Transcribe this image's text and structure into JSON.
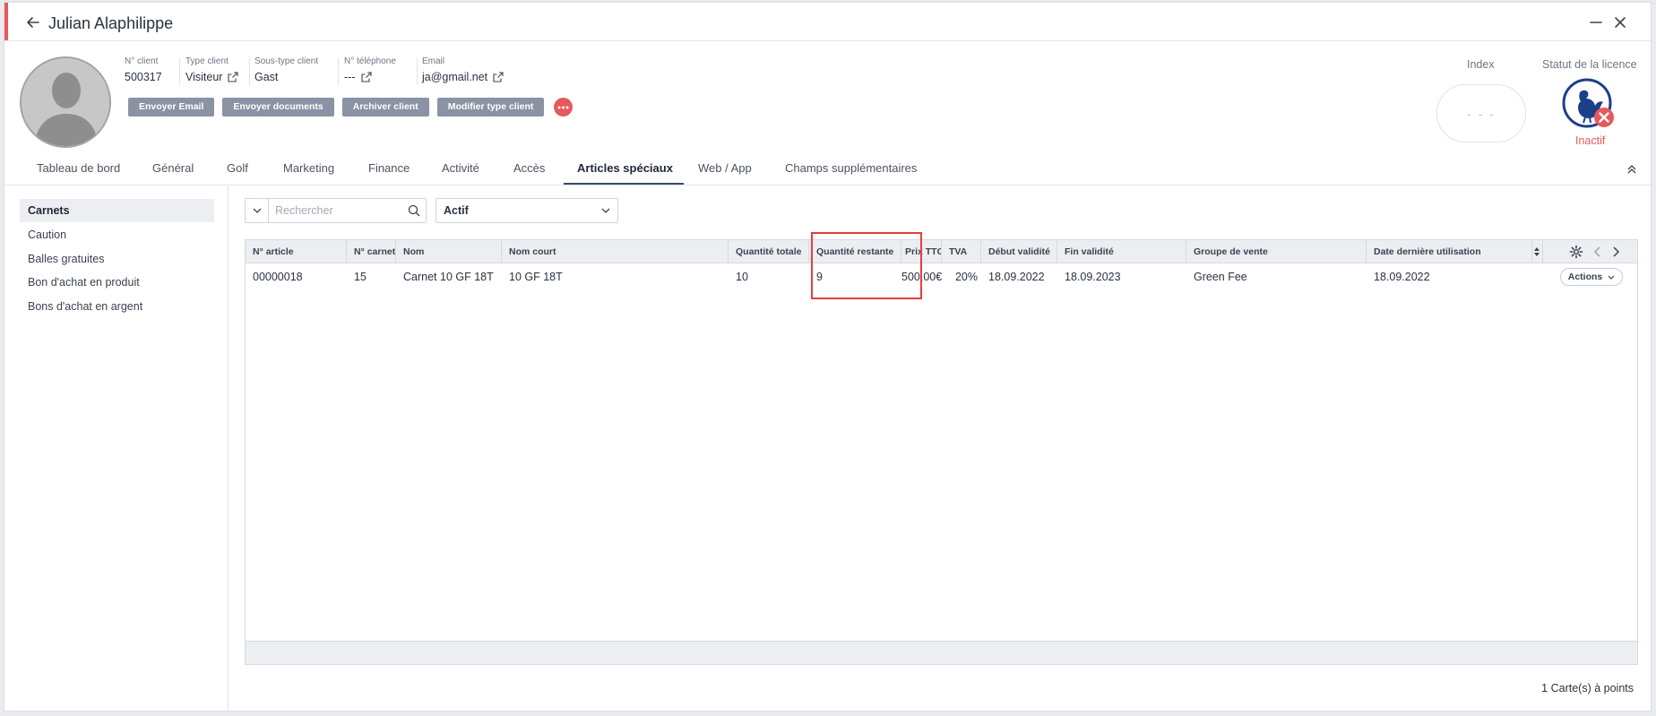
{
  "window": {
    "title": "Julian Alaphilippe"
  },
  "client": {
    "fields": [
      {
        "label": "N° client",
        "value": "500317",
        "link": false
      },
      {
        "label": "Type client",
        "value": "Visiteur",
        "link": true
      },
      {
        "label": "Sous-type client",
        "value": "Gast",
        "link": false
      },
      {
        "label": "N° téléphone",
        "value": "---",
        "link": true
      },
      {
        "label": "Email",
        "value": "ja@gmail.net",
        "link": true
      }
    ],
    "actions": [
      "Envoyer Email",
      "Envoyer documents",
      "Archiver client",
      "Modifier type client"
    ]
  },
  "index": {
    "label": "Index",
    "value": "- - -"
  },
  "licence": {
    "label": "Statut de la licence",
    "status": "Inactif"
  },
  "tabs": [
    "Tableau de bord",
    "Général",
    "Golf",
    "Marketing",
    "Finance",
    "Activité",
    "Accès",
    "Articles spéciaux",
    "Web / App",
    "Champs supplémentaires"
  ],
  "active_tab": "Articles spéciaux",
  "sidenav": [
    "Carnets",
    "Caution",
    "Balles gratuites",
    "Bon d'achat en produit",
    "Bons d'achat en argent"
  ],
  "filters": {
    "search_placeholder": "Rechercher",
    "status_value": "Actif"
  },
  "table": {
    "columns": [
      "N° article",
      "N° carnet",
      "Nom",
      "Nom court",
      "Quantité totale",
      "Quantité restante",
      "Prix TTC",
      "TVA",
      "Début validité",
      "Fin validité",
      "Groupe de vente",
      "Date dernière utilisation"
    ],
    "rows": [
      [
        "00000018",
        "15",
        "Carnet 10 GF 18T",
        "10 GF 18T",
        "10",
        "9",
        "500,00€",
        "20%",
        "18.09.2022",
        "18.09.2023",
        "Green Fee",
        "18.09.2022"
      ]
    ],
    "row_action": "Actions"
  },
  "footer": {
    "count_text": "1 Carte(s) à points"
  },
  "colors": {
    "accent": "#e8595b",
    "button_grey": "#8a93a3",
    "highlight": "#e53d3d",
    "licence_blue": "#1d3f8a"
  }
}
